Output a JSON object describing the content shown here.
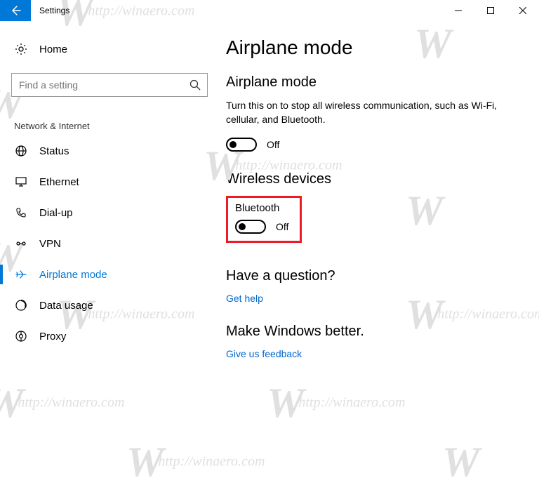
{
  "window": {
    "title": "Settings"
  },
  "watermark_text": "http://winaero.com",
  "sidebar": {
    "home_label": "Home",
    "search_placeholder": "Find a setting",
    "group_header": "Network & Internet",
    "items": [
      {
        "label": "Status"
      },
      {
        "label": "Ethernet"
      },
      {
        "label": "Dial-up"
      },
      {
        "label": "VPN"
      },
      {
        "label": "Airplane mode"
      },
      {
        "label": "Data usage"
      },
      {
        "label": "Proxy"
      }
    ]
  },
  "content": {
    "page_title": "Airplane mode",
    "section1": {
      "title": "Airplane mode",
      "description": "Turn this on to stop all wireless communication, such as Wi-Fi, cellular, and Bluetooth.",
      "toggle_state": "Off"
    },
    "section2": {
      "title": "Wireless devices",
      "item_label": "Bluetooth",
      "toggle_state": "Off"
    },
    "section3": {
      "title": "Have a question?",
      "link": "Get help"
    },
    "section4": {
      "title": "Make Windows better.",
      "link": "Give us feedback"
    }
  }
}
